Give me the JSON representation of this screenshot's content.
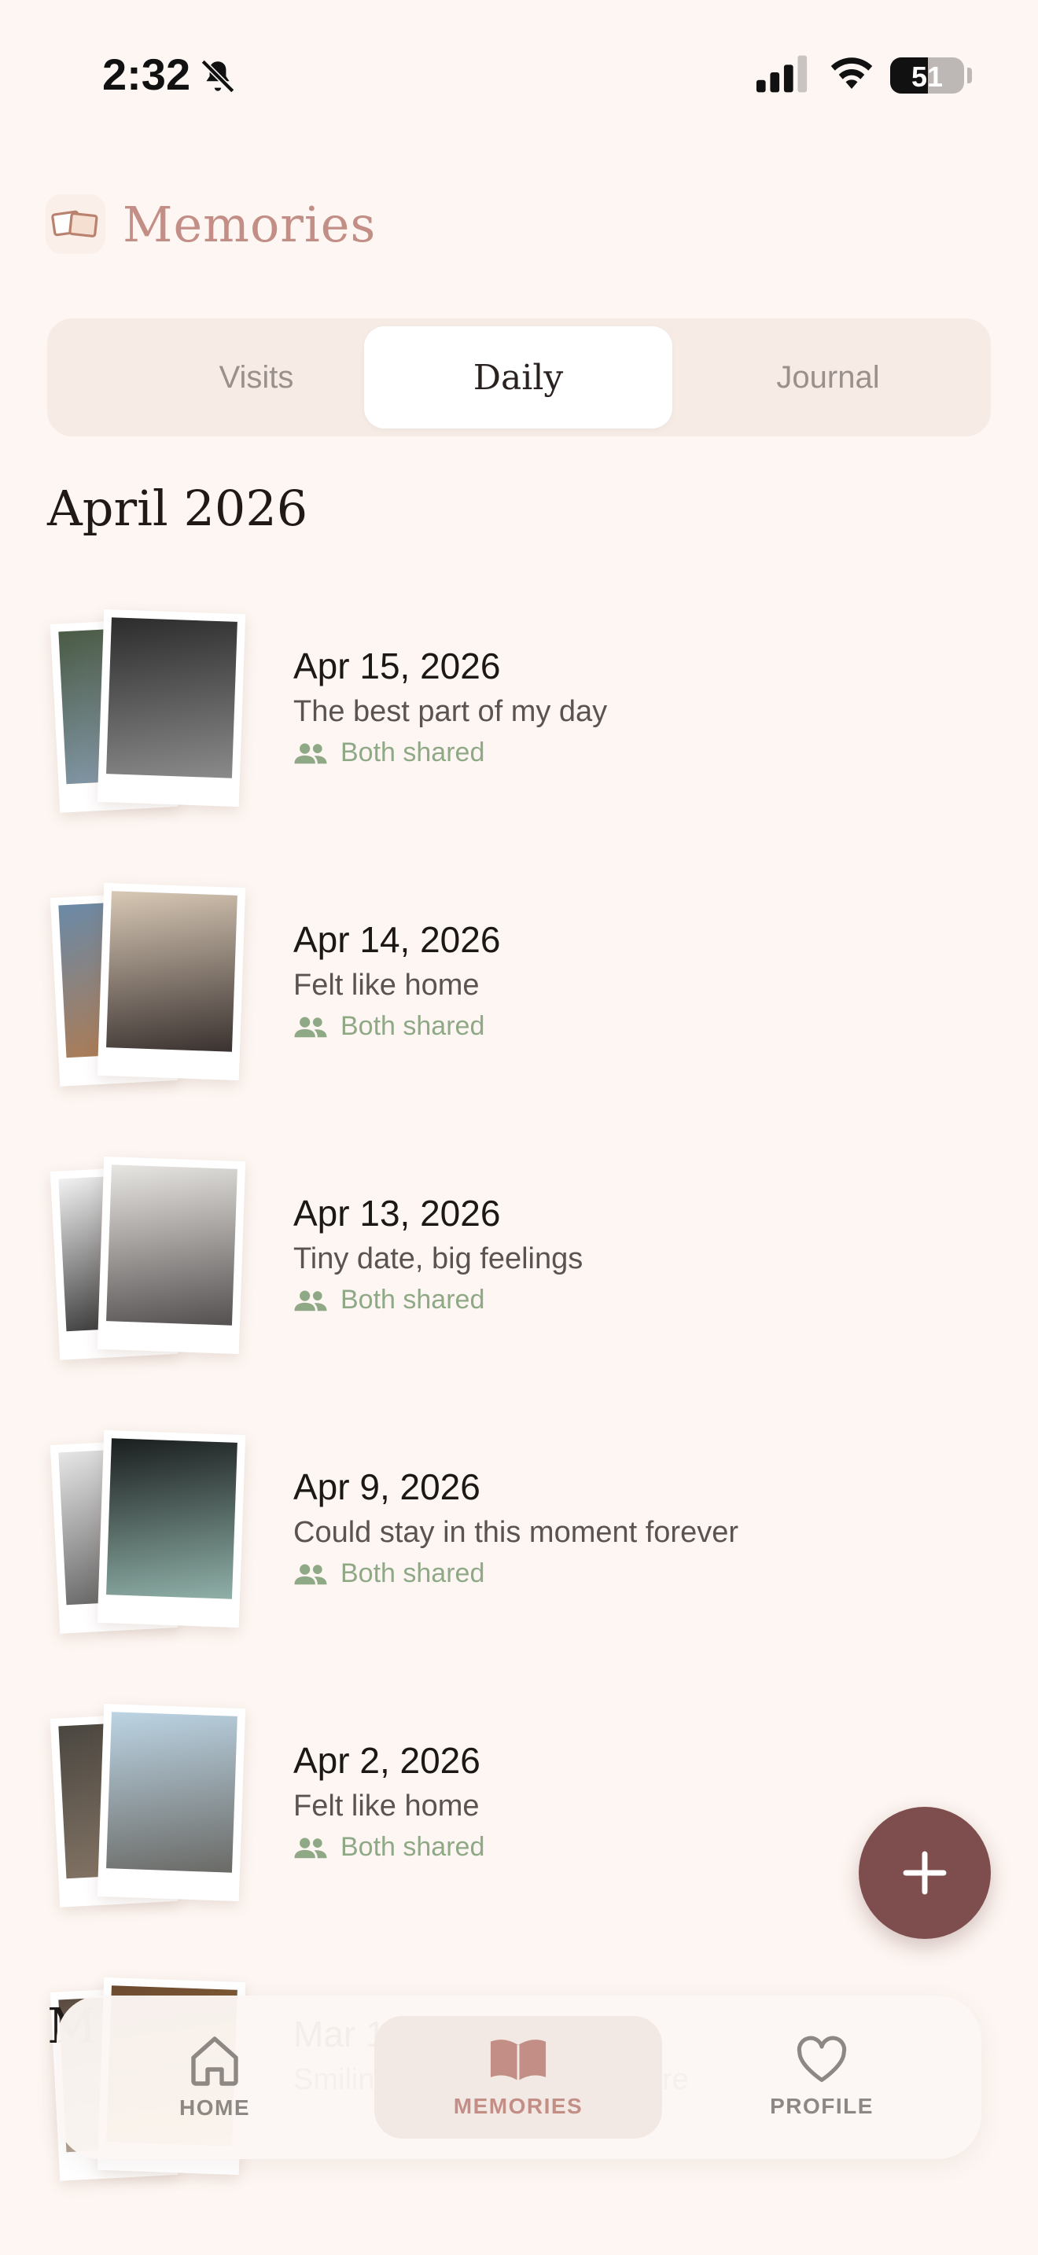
{
  "status_bar": {
    "time": "2:32",
    "battery": "51",
    "battery_level": 0.51
  },
  "header": {
    "title": "Memories",
    "icon": "photos-icon"
  },
  "tabs": {
    "visits": "Visits",
    "daily": "Daily",
    "journal": "Journal",
    "selected": "Daily"
  },
  "month": "April 2026",
  "next_month_partial": "M",
  "entries": [
    {
      "date": "Apr 15, 2026",
      "caption": "The best part of my day",
      "shared": "Both shared",
      "back_colors": [
        "#4a5a44",
        "#8aa0b5"
      ],
      "front_colors": [
        "#2c2c2c",
        "#8a8a8a"
      ]
    },
    {
      "date": "Apr 14, 2026",
      "caption": "Felt like home",
      "shared": "Both shared",
      "back_colors": [
        "#6a8aa8",
        "#b57a4a"
      ],
      "front_colors": [
        "#d8c8b5",
        "#3a3230"
      ]
    },
    {
      "date": "Apr 13, 2026",
      "caption": "Tiny date, big feelings",
      "shared": "Both shared",
      "back_colors": [
        "#f2f2f2",
        "#222222"
      ],
      "front_colors": [
        "#e8e6e2",
        "#555050"
      ]
    },
    {
      "date": "Apr 9, 2026",
      "caption": "Could stay in this moment forever",
      "shared": "Both shared",
      "back_colors": [
        "#e6e6e6",
        "#555555"
      ],
      "front_colors": [
        "#1a1e1e",
        "#8fb0a8"
      ]
    },
    {
      "date": "Apr 2, 2026",
      "caption": "Felt like home",
      "shared": "Both shared",
      "back_colors": [
        "#4a4640",
        "#8a7a6a"
      ],
      "front_colors": [
        "#bcd4e4",
        "#6a6a66"
      ]
    },
    {
      "date": "Mar 17, 2026",
      "caption": "Smiling because you are here",
      "shared": "",
      "back_colors": [
        "#5a4a40",
        "#c8b8a8"
      ],
      "front_colors": [
        "#6a4a30",
        "#d8a04a"
      ]
    }
  ],
  "tabbar": {
    "home": "HOME",
    "memories": "MEMORIES",
    "profile": "PROFILE",
    "selected": "MEMORIES"
  },
  "colors": {
    "background": "#fdf6f2",
    "accent": "#c28e86",
    "fab": "#7e4d4d",
    "shared": "#8fa886"
  }
}
